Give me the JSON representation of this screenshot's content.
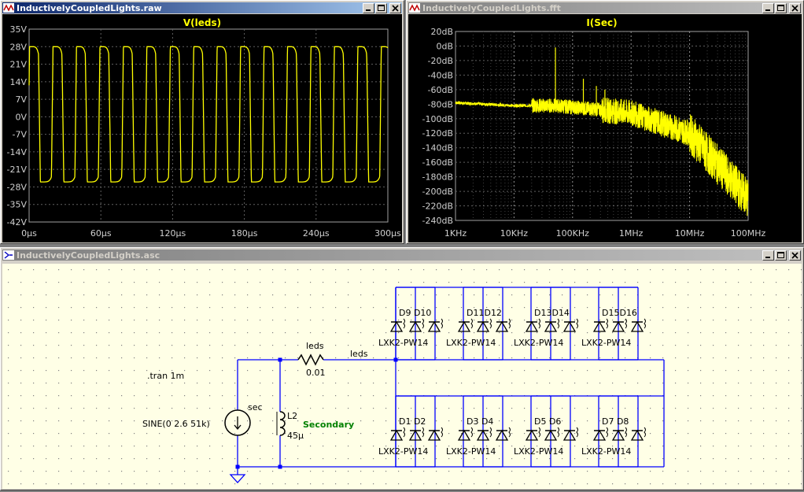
{
  "windows": {
    "raw": {
      "title": "InductivelyCoupledLights.raw",
      "trace_label": "V(leds)",
      "y_ticks": [
        "35V",
        "28V",
        "21V",
        "14V",
        "7V",
        "0V",
        "-7V",
        "-14V",
        "-21V",
        "-28V",
        "-35V",
        "-42V"
      ],
      "x_ticks": [
        "0µs",
        "60µs",
        "120µs",
        "180µs",
        "240µs",
        "300µs"
      ]
    },
    "fft": {
      "title": "InductivelyCoupledLights.fft",
      "trace_label": "I(Sec)",
      "y_ticks": [
        "20dB",
        "0dB",
        "-20dB",
        "-40dB",
        "-60dB",
        "-80dB",
        "-100dB",
        "-120dB",
        "-140dB",
        "-160dB",
        "-180dB",
        "-200dB",
        "-220dB",
        "-240dB"
      ],
      "x_ticks": [
        "1KHz",
        "10KHz",
        "100KHz",
        "1MHz",
        "10MHz",
        "100MHz"
      ]
    },
    "asc": {
      "title": "InductivelyCoupledLights.asc"
    }
  },
  "schematic": {
    "directive": ".tran 1m",
    "source_name": "sec",
    "source_value": "SINE(0 2.6 51k)",
    "inductor_name": "L2",
    "inductor_value": "45µ",
    "inductor_comment": "Secondary",
    "resistor_name": "leds",
    "resistor_value": "0.01",
    "net_label": "leds",
    "top_diodes": [
      {
        "names": "D9 D10",
        "parts": "LXK2-PW14"
      },
      {
        "names": "D11D12",
        "parts": "LXK2-PW14"
      },
      {
        "names": "D13D14",
        "parts": "LXK2-PW14"
      },
      {
        "names": "D15D16",
        "parts": "LXK2-PW14"
      }
    ],
    "bottom_diodes": [
      {
        "names": "D1   D2",
        "parts": "LXK2-PW14"
      },
      {
        "names": "D3   D4",
        "parts": "LXK2-PW14"
      },
      {
        "names": "D5   D6",
        "parts": "LXK2-PW14"
      },
      {
        "names": "D7   D8",
        "parts": "LXK2-PW14"
      }
    ]
  },
  "colors": {
    "trace": "#ffff00",
    "wire": "#0000ff",
    "comment": "#008000",
    "grid": "#606060"
  },
  "chart_data": [
    {
      "type": "line",
      "title": "V(leds)",
      "xlim": [
        0,
        300
      ],
      "ylim": [
        -42,
        35
      ],
      "x_unit": "µs",
      "y_unit": "V",
      "series": [
        {
          "name": "V(leds)",
          "x": [
            0,
            300
          ],
          "y": [
            27,
            -27
          ]
        }
      ],
      "note_shape": "square-ish wave swinging between about 28V and -26V, 15 cycles"
    },
    {
      "type": "line",
      "title": "I(Sec)",
      "log_x": true,
      "xlim": [
        1000,
        100000000
      ],
      "ylim": [
        -240,
        20
      ],
      "y_unit": "dB",
      "series": [
        {
          "name": "I(Sec)",
          "x": [
            1000,
            10000,
            50000,
            100000,
            1000000,
            10000000,
            100000000
          ],
          "y": [
            -78,
            -82,
            -82,
            -84,
            -92,
            -120,
            -210
          ]
        }
      ]
    }
  ]
}
